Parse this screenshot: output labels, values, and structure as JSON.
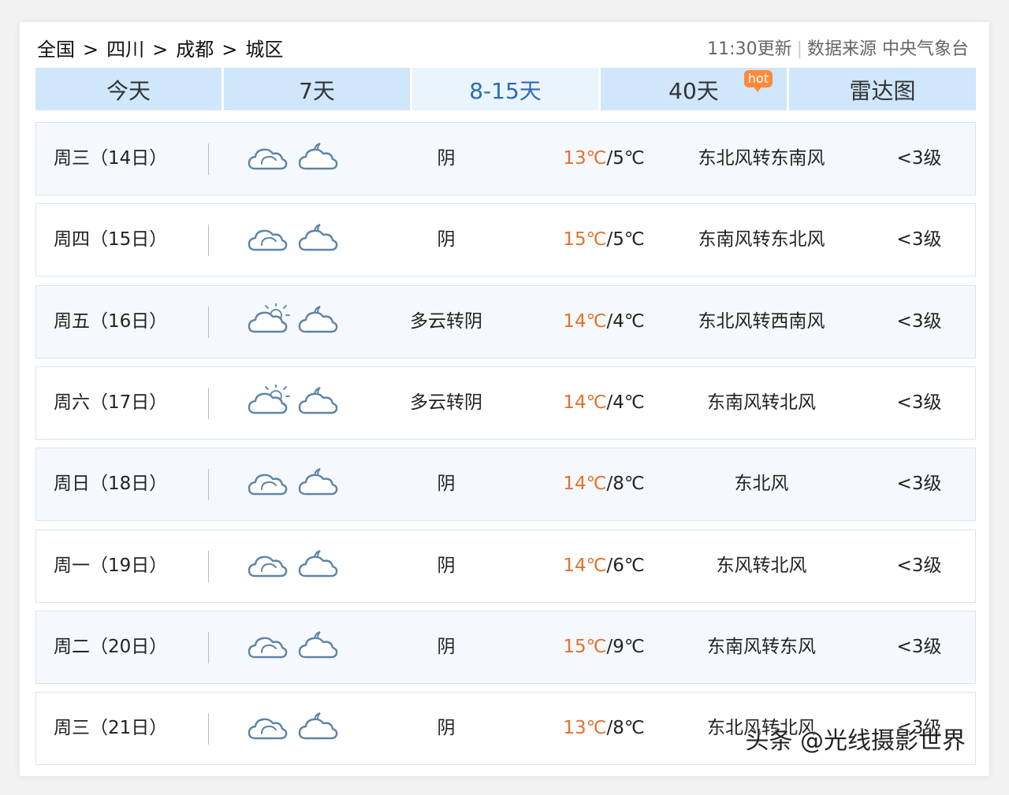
{
  "breadcrumb": [
    "全国",
    "四川",
    "成都",
    "城区"
  ],
  "breadcrumb_sep": ">",
  "meta": {
    "update_time": "11:30更新",
    "source": "数据来源 中央气象台"
  },
  "tabs": [
    {
      "label": "今天"
    },
    {
      "label": "7天"
    },
    {
      "label": "8-15天"
    },
    {
      "label": "40天",
      "badge": "hot"
    },
    {
      "label": "雷达图"
    }
  ],
  "active_tab": "8-15天",
  "colors": {
    "tab_bg": "#cfe6fb",
    "tab_active_bg": "#eaf4fd",
    "tab_active_text": "#2b6cb8",
    "high_temp": "#e5702a",
    "hot_badge": "#ff8a3c"
  },
  "forecast": [
    {
      "day": "周三（14日）",
      "icon_day": "cloudy-icon",
      "icon_night": "cloudy-night-icon",
      "desc": "阴",
      "high": "13℃",
      "low": "5℃",
      "wind": "东北风转东南风",
      "level": "<3级"
    },
    {
      "day": "周四（15日）",
      "icon_day": "cloudy-icon",
      "icon_night": "cloudy-night-icon",
      "desc": "阴",
      "high": "15℃",
      "low": "5℃",
      "wind": "东南风转东北风",
      "level": "<3级"
    },
    {
      "day": "周五（16日）",
      "icon_day": "partly-cloudy-icon",
      "icon_night": "cloudy-night-icon",
      "desc": "多云转阴",
      "high": "14℃",
      "low": "4℃",
      "wind": "东北风转西南风",
      "level": "<3级"
    },
    {
      "day": "周六（17日）",
      "icon_day": "partly-cloudy-icon",
      "icon_night": "cloudy-night-icon",
      "desc": "多云转阴",
      "high": "14℃",
      "low": "4℃",
      "wind": "东南风转北风",
      "level": "<3级"
    },
    {
      "day": "周日（18日）",
      "icon_day": "cloudy-icon",
      "icon_night": "cloudy-night-icon",
      "desc": "阴",
      "high": "14℃",
      "low": "8℃",
      "wind": "东北风",
      "level": "<3级"
    },
    {
      "day": "周一（19日）",
      "icon_day": "cloudy-icon",
      "icon_night": "cloudy-night-icon",
      "desc": "阴",
      "high": "14℃",
      "low": "6℃",
      "wind": "东风转北风",
      "level": "<3级"
    },
    {
      "day": "周二（20日）",
      "icon_day": "cloudy-icon",
      "icon_night": "cloudy-night-icon",
      "desc": "阴",
      "high": "15℃",
      "low": "9℃",
      "wind": "东南风转东风",
      "level": "<3级"
    },
    {
      "day": "周三（21日）",
      "icon_day": "cloudy-icon",
      "icon_night": "cloudy-night-icon",
      "desc": "阴",
      "high": "13℃",
      "low": "8℃",
      "wind": "东北风转北风",
      "level": "<3级"
    }
  ],
  "watermark": "头条 @光线摄影世界"
}
